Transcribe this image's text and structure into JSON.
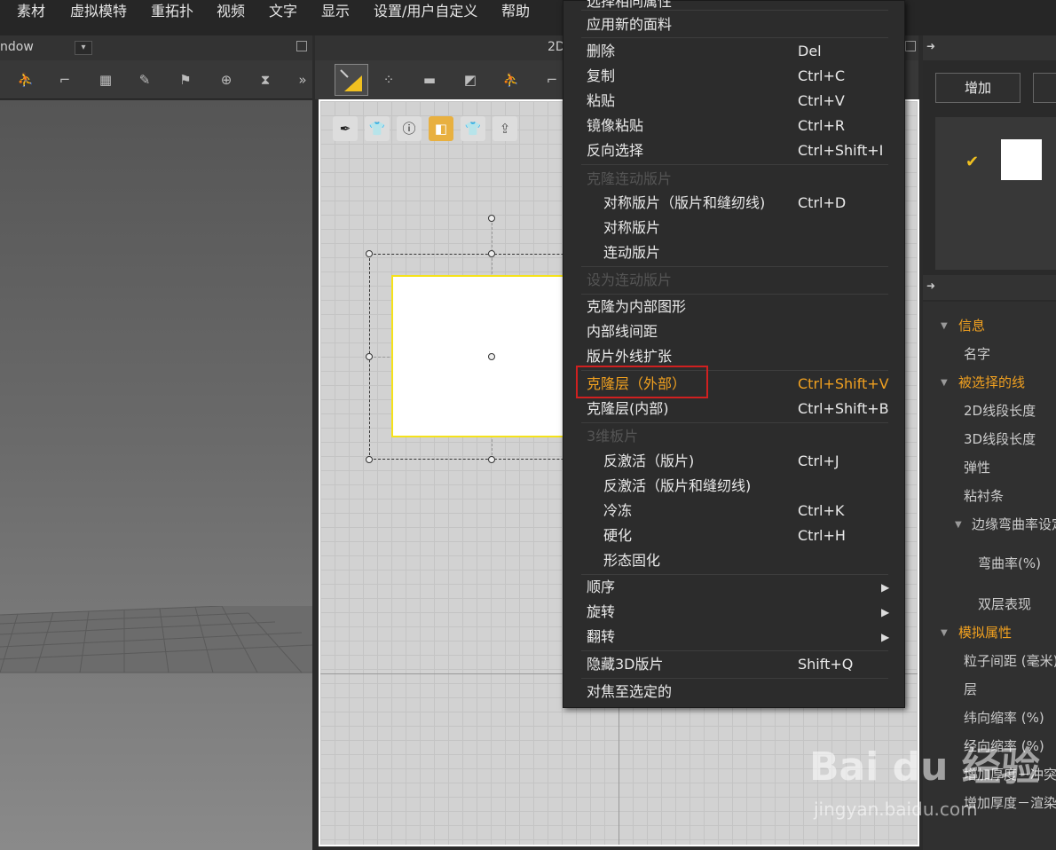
{
  "menubar": {
    "items": [
      "素材",
      "虚拟模特",
      "重拓扑",
      "视频",
      "文字",
      "显示",
      "设置/用户自定义",
      "帮助"
    ]
  },
  "left_panel": {
    "window_label": "ndow",
    "dropdown": "▾"
  },
  "mid_panel": {
    "title": "2D"
  },
  "right_panel": {
    "add_label": "增加"
  },
  "properties": {
    "info": "信息",
    "name": "名字",
    "selected_line": "被选择的线",
    "len2d": "2D线段长度",
    "len3d": "3D线段长度",
    "elastic": "弹性",
    "tape": "粘衬条",
    "edge_curve": "边缘弯曲率设定",
    "curve_pct": "弯曲率(%)",
    "double_layer": "双层表现",
    "sim": "模拟属性",
    "particle": "粒子间距 (毫米)",
    "layer": "层",
    "weft": "纬向缩率 (%)",
    "warp": "经向缩率 (%)",
    "thick_coll": "增加厚度－冲突",
    "thick_render": "增加厚度－渲染"
  },
  "context_menu": {
    "items": [
      {
        "label": "选择相同属性",
        "shortcut": ""
      },
      {
        "label": "应用新的面料",
        "shortcut": ""
      },
      {
        "label": "删除",
        "shortcut": "Del"
      },
      {
        "label": "复制",
        "shortcut": "Ctrl+C"
      },
      {
        "label": "粘贴",
        "shortcut": "Ctrl+V"
      },
      {
        "label": "镜像粘贴",
        "shortcut": "Ctrl+R"
      },
      {
        "label": "反向选择",
        "shortcut": "Ctrl+Shift+I"
      },
      {
        "label": "克隆连动版片",
        "shortcut": ""
      },
      {
        "label": "对称版片（版片和缝纫线)",
        "shortcut": "Ctrl+D"
      },
      {
        "label": "对称版片",
        "shortcut": ""
      },
      {
        "label": "连动版片",
        "shortcut": ""
      },
      {
        "label": "设为连动版片",
        "shortcut": ""
      },
      {
        "label": "克隆为内部图形",
        "shortcut": ""
      },
      {
        "label": "内部线间距",
        "shortcut": ""
      },
      {
        "label": "版片外线扩张",
        "shortcut": ""
      },
      {
        "label": "克隆层（外部）",
        "shortcut": "Ctrl+Shift+V"
      },
      {
        "label": "克隆层(内部)",
        "shortcut": "Ctrl+Shift+B"
      },
      {
        "label": "3维板片",
        "shortcut": ""
      },
      {
        "label": "反激活（版片)",
        "shortcut": "Ctrl+J"
      },
      {
        "label": "反激活（版片和缝纫线)",
        "shortcut": ""
      },
      {
        "label": "冷冻",
        "shortcut": "Ctrl+K"
      },
      {
        "label": "硬化",
        "shortcut": "Ctrl+H"
      },
      {
        "label": "形态固化",
        "shortcut": ""
      },
      {
        "label": "顺序",
        "shortcut": ""
      },
      {
        "label": "旋转",
        "shortcut": ""
      },
      {
        "label": "翻转",
        "shortcut": ""
      },
      {
        "label": "隐藏3D版片",
        "shortcut": "Shift+Q"
      },
      {
        "label": "对焦至选定的",
        "shortcut": ""
      }
    ]
  },
  "watermark": {
    "logo": "Bai du 经验",
    "url": "jingyan.baidu.com"
  }
}
